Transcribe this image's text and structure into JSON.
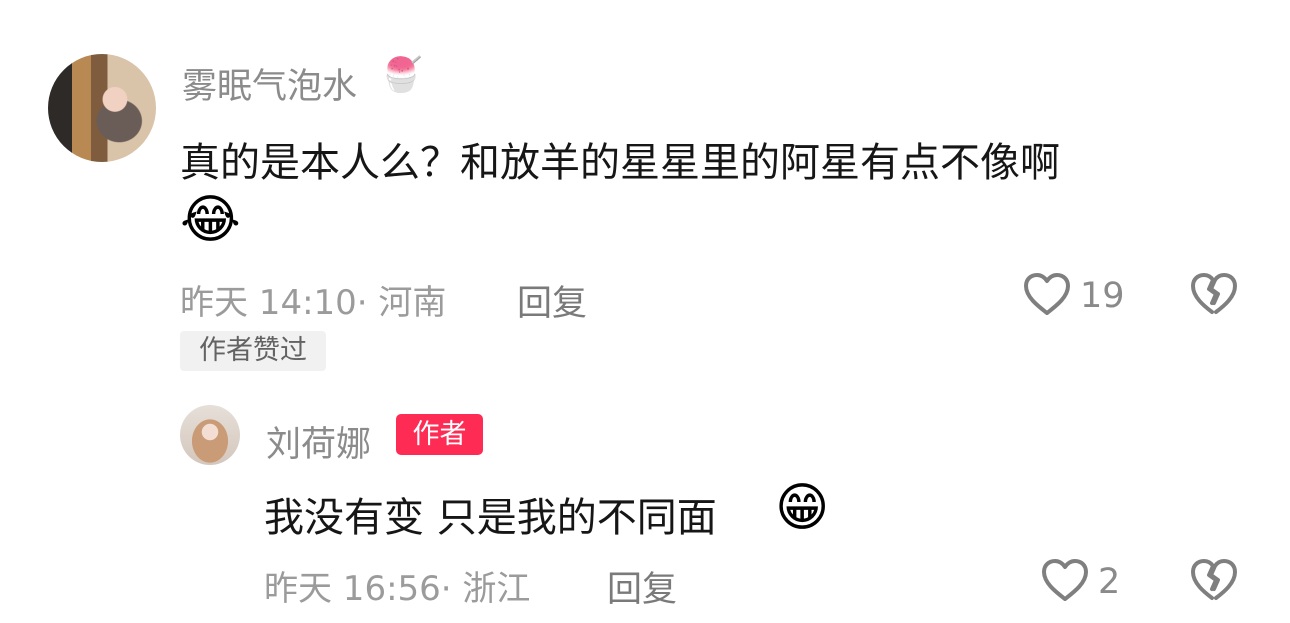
{
  "comments": [
    {
      "username": "雾眠气泡水",
      "username_emoji": "🍧",
      "text": "真的是本人么？和放羊的星星里的阿星有点不像啊",
      "emoji": "😂",
      "timestamp_location": "昨天 14:10· 河南",
      "reply_label": "回复",
      "like_count": "19",
      "author_liked_label": "作者赞过",
      "like_icon": "heart-outline-icon",
      "dislike_icon": "broken-heart-icon"
    },
    {
      "username": "刘荷娜",
      "badge": "作者",
      "text": "我没有变 只是我的不同面",
      "emoji": "😁",
      "timestamp_location": "昨天 16:56· 浙江",
      "reply_label": "回复",
      "like_count": "2",
      "like_icon": "heart-outline-icon",
      "dislike_icon": "broken-heart-icon"
    }
  ],
  "colors": {
    "author_badge_bg": "#fe2c55",
    "meta_text": "#9b9b9b",
    "tag_bg": "#f1f1f1",
    "icon": "#7f7f7f"
  }
}
